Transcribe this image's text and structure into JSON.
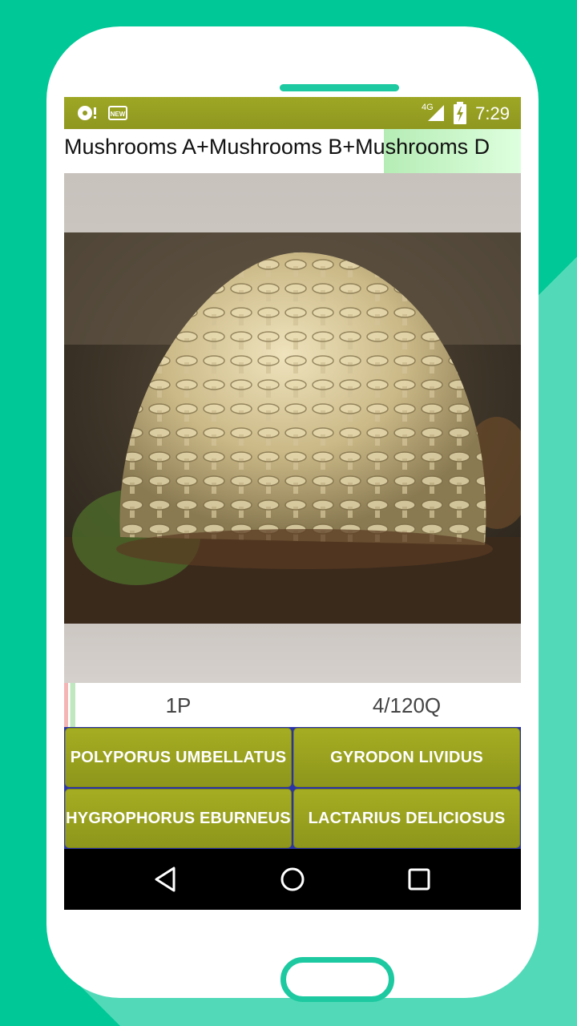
{
  "status_bar": {
    "icons": [
      "notification-icon",
      "new-badge-icon",
      "network-4g-icon",
      "signal-icon",
      "battery-charging-icon"
    ],
    "new_badge": "NEW",
    "network": "4G",
    "time": "7:29"
  },
  "header": {
    "title": "Mushrooms A+Mushrooms B+Mushrooms D"
  },
  "quiz": {
    "player": "1P",
    "progress": "4/120Q"
  },
  "answers": [
    {
      "label": "POLYPORUS UMBELLATUS"
    },
    {
      "label": "GYRODON LIVIDUS"
    },
    {
      "label": "HYGROPHORUS EBURNEUS"
    },
    {
      "label": "LACTARIUS DELICIOSUS"
    }
  ],
  "nav": {
    "icons": [
      "back-icon",
      "home-icon",
      "recents-icon"
    ]
  },
  "colors": {
    "background": "#00c896",
    "accent": "#1dc9a0",
    "button": "#9aa21f",
    "status_bar": "#9ea724"
  }
}
